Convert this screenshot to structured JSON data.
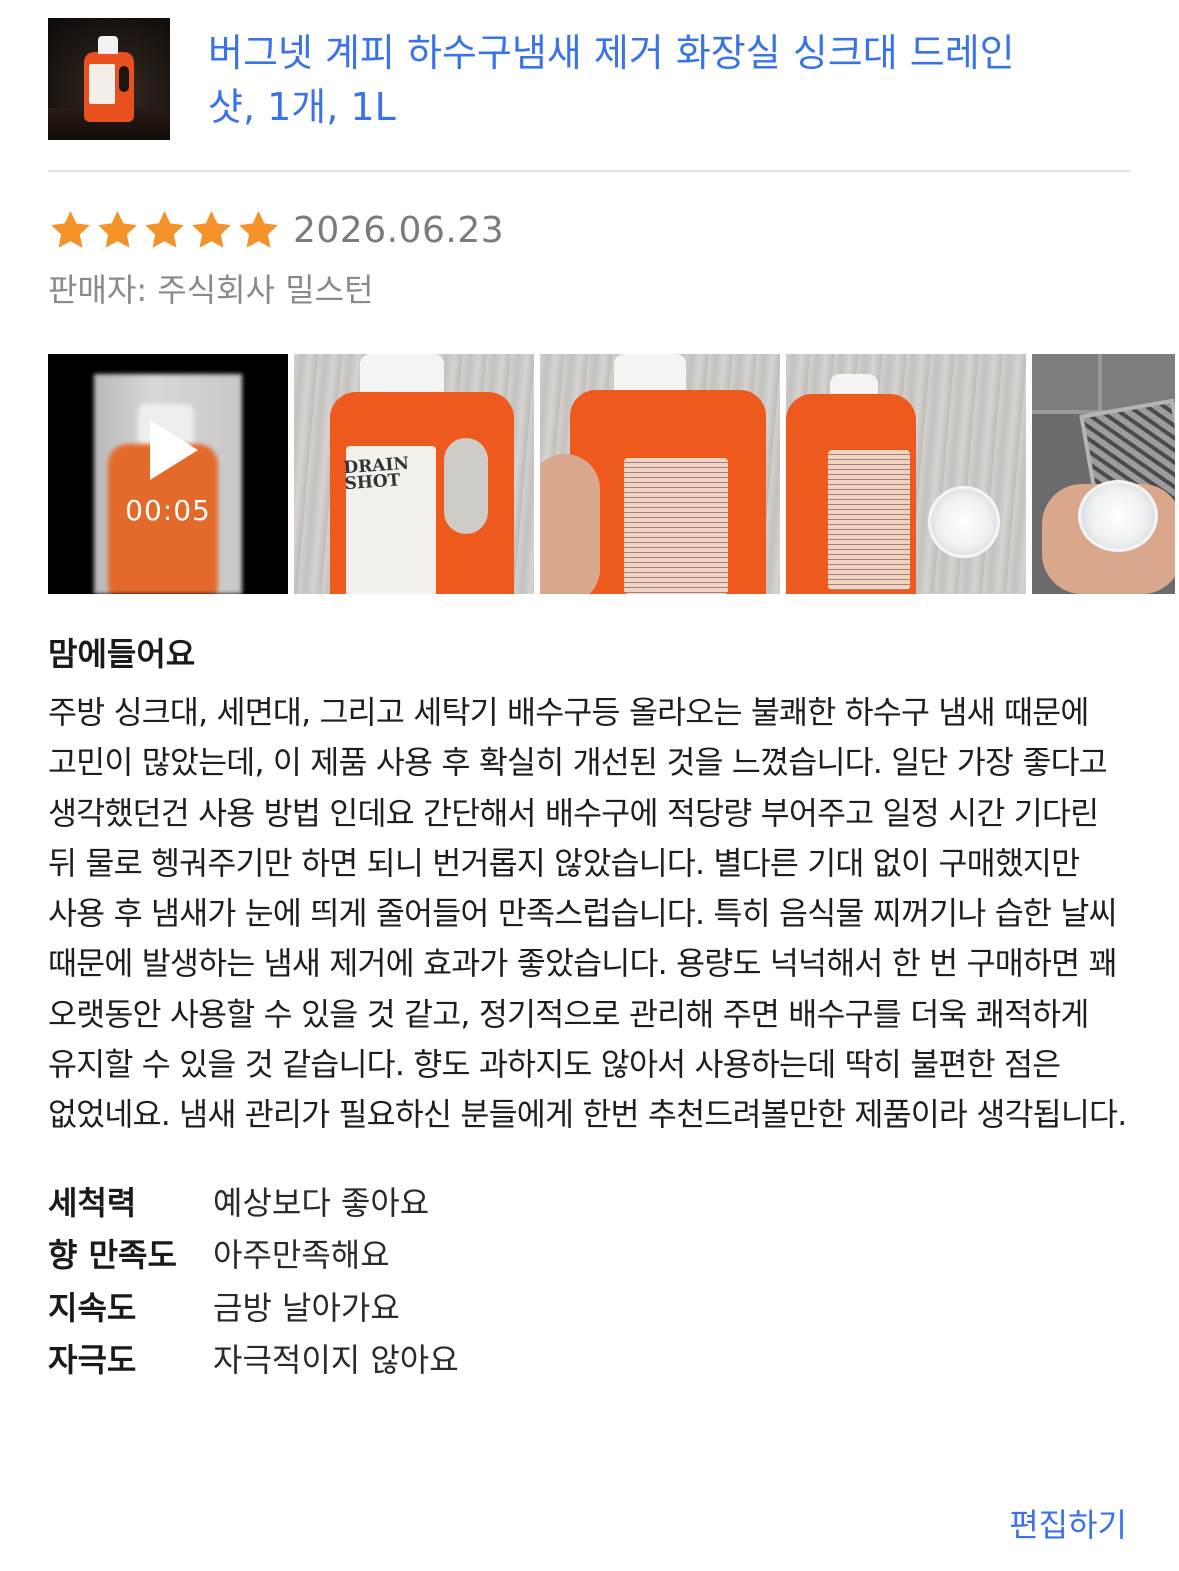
{
  "product": {
    "title": "버그넷 계피 하수구냄새 제거 화장실 싱크대 드레인샷, 1개, 1L",
    "thumbnail_label": "DRAIN SHOT"
  },
  "review": {
    "rating": 5,
    "rating_max": 5,
    "date": "2026.06.23",
    "seller": "판매자: 주식회사 밀스턴",
    "headline": "맘에들어요",
    "body": "주방 싱크대, 세면대, 그리고 세탁기 배수구등 올라오는 불쾌한 하수구 냄새 때문에 고민이 많았는데, 이 제품 사용 후 확실히 개선된 것을 느꼈습니다. 일단 가장 좋다고 생각했던건 사용 방법 인데요  간단해서 배수구에 적당량 부어주고 일정 시간 기다린 뒤 물로 헹궈주기만 하면 되니 번거롭지 않았습니다. 별다른 기대 없이 구매했지만 사용 후 냄새가 눈에 띄게 줄어들어 만족스럽습니다. 특히 음식물 찌꺼기나 습한 날씨 때문에 발생하는 냄새 제거에 효과가 좋았습니다. 용량도 넉넉해서 한 번 구매하면 꽤 오랫동안 사용할 수 있을 것 같고, 정기적으로 관리해 주면 배수구를 더욱 쾌적하게 유지할 수 있을 것 같습니다. 향도 과하지도 않아서 사용하는데 딱히 불편한 점은 없었네요. 냄새 관리가 필요하신 분들에게 한번 추천드려볼만한 제품이라 생각됩니다.",
    "media": {
      "video_duration": "00:05",
      "photo_1_label_line1": "DRAIN",
      "photo_1_label_line2": "SHOT"
    },
    "attributes": [
      {
        "key": "세척력",
        "value": "예상보다 좋아요"
      },
      {
        "key": "향 만족도",
        "value": "아주만족해요"
      },
      {
        "key": "지속도",
        "value": "금방 날아가요"
      },
      {
        "key": "자극도",
        "value": "자극적이지 않아요"
      }
    ]
  },
  "actions": {
    "edit_label": "편집하기"
  },
  "colors": {
    "link": "#3a73e8",
    "star": "#f5922a",
    "muted": "#7b7b7b",
    "divider": "#e4e4e4"
  },
  "icons": {
    "star": "star-icon",
    "play": "play-icon"
  }
}
